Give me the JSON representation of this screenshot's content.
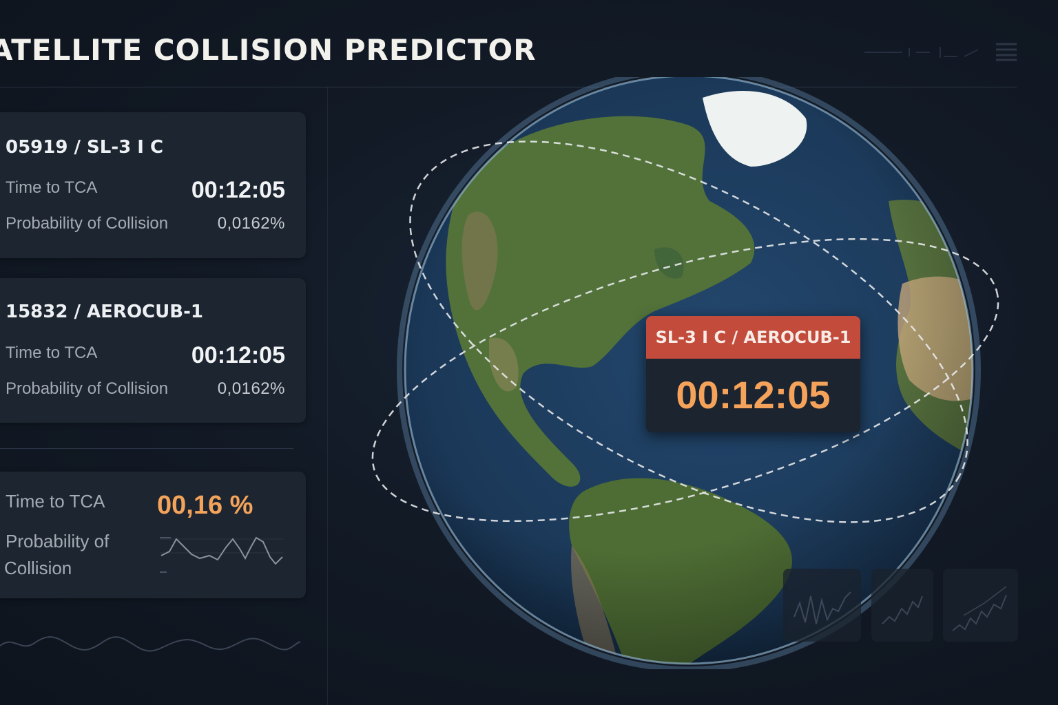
{
  "app": {
    "title": "ATELLITE COLLISION PREDICTOR"
  },
  "conjunctions": [
    {
      "name": "05919 / SL-3 I C",
      "tca_label": "Time to TCA",
      "tca_value": "00:12:05",
      "prob_label": "Probability of Collision",
      "prob_value": "0,0162%"
    },
    {
      "name": "15832 / AEROCUB-1",
      "tca_label": "Time to TCA",
      "tca_value": "00:12:05",
      "prob_label": "Probability of Collision",
      "prob_value": "0,0162%"
    }
  ],
  "summary": {
    "tca_label": "Time to TCA",
    "prob_label_line1": "Probability of",
    "prob_label_line2": "Collision",
    "value": "00,16 %"
  },
  "tooltip": {
    "title": "SL-3 I C / AEROCUB-1",
    "time": "00:12:05"
  },
  "icons": {
    "header": [
      "chart-icon",
      "menu-icon"
    ],
    "mini_charts": [
      "line-chart-icon",
      "trend-chart-icon",
      "rising-chart-icon"
    ]
  },
  "colors": {
    "accent": "#f4a35a",
    "alert": "#c24b3b",
    "background": "#121a26",
    "card": "#1d2530"
  }
}
